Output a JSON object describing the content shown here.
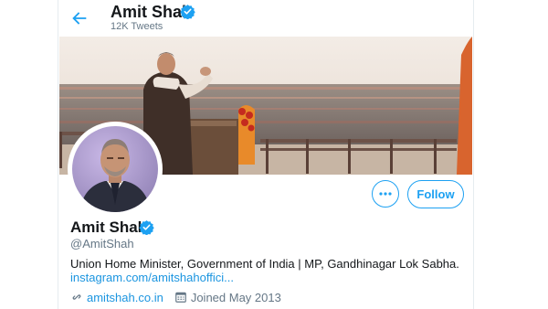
{
  "header": {
    "name": "Amit Shah",
    "tweet_count": "12K Tweets"
  },
  "profile": {
    "name": "Amit Shah",
    "handle": "@AmitShah",
    "bio": "Union Home Minister, Government of India | MP, Gandhinagar Lok Sabha.",
    "bio_link": "instagram.com/amitshahoffici...",
    "website": "amitshah.co.in",
    "joined": "Joined May 2013"
  },
  "actions": {
    "more_label": "•••",
    "follow_label": "Follow"
  },
  "icons": {
    "back": "back-arrow-icon",
    "verified": "verified-badge-icon",
    "link": "link-icon",
    "calendar": "calendar-icon"
  },
  "colors": {
    "accent": "#1da1f2",
    "link": "#1b95e0",
    "muted": "#657786",
    "text": "#14171a"
  }
}
